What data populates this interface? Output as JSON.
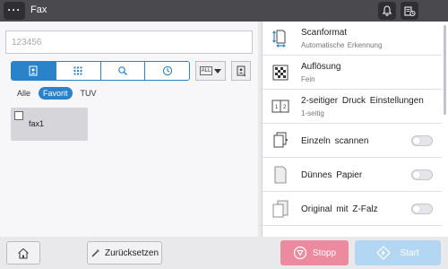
{
  "header": {
    "menu_label": "···",
    "title": "Fax"
  },
  "destination": {
    "placeholder": "123456"
  },
  "search_tabs": [
    {
      "icon": "address-book-icon",
      "active": true
    },
    {
      "icon": "keypad-icon",
      "active": false
    },
    {
      "icon": "search-icon",
      "active": false
    },
    {
      "icon": "history-clock-icon",
      "active": false
    }
  ],
  "index_dropdown": {
    "selected": "ALL"
  },
  "filters": {
    "all": "Alle",
    "favorite": "Favorit",
    "tuv": "TUV",
    "active": "favorite"
  },
  "address_entries": [
    {
      "name": "fax1",
      "checked": false
    }
  ],
  "options": [
    {
      "icon": "scan-format-icon",
      "label": "Scanformat",
      "value": "Automatische  Erkennung"
    },
    {
      "icon": "resolution-icon",
      "label": "Auflösung",
      "value": "Fein"
    },
    {
      "icon": "duplex-icon",
      "label": "2-seitiger Druck Einstellungen",
      "value": "1-seitig"
    },
    {
      "icon": "separate-scan-icon",
      "label": "Einzeln  scannen",
      "toggle": false
    },
    {
      "icon": "thin-paper-icon",
      "label": "Dünnes  Papier",
      "toggle": false
    },
    {
      "icon": "z-fold-icon",
      "label": "Original  mit  Z-Falz",
      "toggle": false
    }
  ],
  "footer": {
    "reset_label": "Zurücksetzen",
    "stop_label": "Stopp",
    "start_label": "Start"
  },
  "colors": {
    "accent": "#2a82c8",
    "stop": "#ec8aa0",
    "start": "#b3d6f2",
    "titlebar": "#4a4a4e"
  }
}
